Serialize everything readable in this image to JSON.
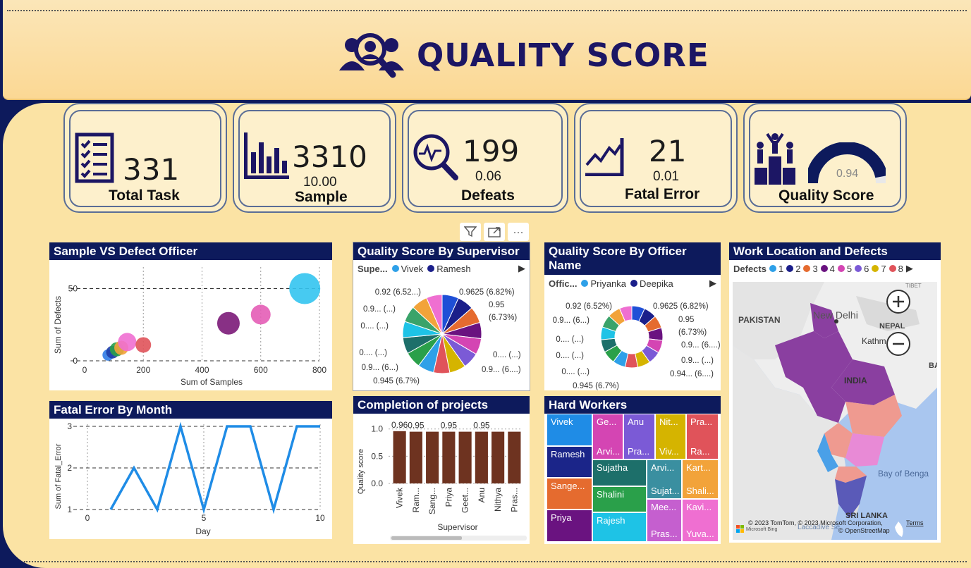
{
  "header": {
    "title": "QUALITY SCORE"
  },
  "kpis": [
    {
      "value": "331",
      "sub": "",
      "label": "Total Task",
      "icon": "checklist-icon"
    },
    {
      "value": "3310",
      "sub": "10.00",
      "label": "Sample",
      "icon": "bar-chart-icon"
    },
    {
      "value": "199",
      "sub": "0.06",
      "label": "Defeats",
      "icon": "magnify-pulse-icon"
    },
    {
      "value": "21",
      "sub": "0.01",
      "label": "Fatal Error",
      "icon": "line-chart-icon"
    },
    {
      "value": "",
      "sub": "0.94",
      "label": "Quality Score",
      "icon": "podium-icon",
      "gauge_fraction": 0.94
    }
  ],
  "toolbar": {
    "filter": "filter-icon",
    "focus": "focus-mode-icon",
    "more": "···"
  },
  "scatter": {
    "title": "Sample VS Defect Officer",
    "xlabel": "Sum of Samples",
    "ylabel": "Sum of Defects",
    "xticks": [
      "0",
      "200",
      "400",
      "600",
      "800"
    ],
    "yticks": [
      "0",
      "50"
    ]
  },
  "pie1": {
    "title": "Quality Score By Supervisor",
    "legend_head": "Supe...",
    "legend": [
      "Vivek",
      "Ramesh"
    ],
    "labels": [
      "0.92 (6.52...)",
      "0.9625 (6.82%)",
      "0.9... (...)",
      "0.95",
      "(6.73%)",
      "0.... (...)",
      "0.... (...)",
      "0.... (...)",
      "0.9... (6...)",
      "0.9... (6....)",
      "0.945 (6.7%)"
    ]
  },
  "pie2": {
    "title": "Quality Score By Officer Name",
    "legend_head": "Offic...",
    "legend": [
      "Priyanka",
      "Deepika"
    ],
    "labels": [
      "0.92 (6.52%)",
      "0.9625 (6.82%)",
      "0.9... (6...)",
      "0.95",
      "(6.73%)",
      "0.... (...)",
      "0.... (...)",
      "0.9... (...)",
      "0.... (...)",
      "0.94... (6....)",
      "0.9... (6....)",
      "0.945 (6.7%)"
    ]
  },
  "map": {
    "title": "Work Location and Defects",
    "legend_head": "Defects",
    "legend": [
      "1",
      "2",
      "3",
      "4",
      "5",
      "6",
      "7",
      "8"
    ],
    "places": [
      "PAKISTAN",
      "New Delhi",
      "NEPAL",
      "Kathm",
      "INDIA",
      "Bay of Benga",
      "SRI LANKA",
      "TIBET",
      "BA",
      "Laccadive Se"
    ],
    "attribution": "© 2023 TomTom, © 2023 Microsoft Corporation,",
    "terms": "Terms",
    "osm": "© OpenStreetMap",
    "bing": "Microsoft Bing"
  },
  "line": {
    "title": "Fatal Error By Month",
    "xlabel": "Day",
    "ylabel": "Sum of Fatal_Error",
    "xticks": [
      "0",
      "5",
      "10"
    ],
    "yticks": [
      "1",
      "2",
      "3"
    ]
  },
  "bars": {
    "title": "Completion of projects",
    "xlabel": "Supervisor",
    "ylabel": "Quality score",
    "yticks": [
      "0.0",
      "0.5",
      "1.0"
    ],
    "value_labels": [
      "0.96",
      "0.95",
      "0.95",
      "0.95"
    ]
  },
  "treemap": {
    "title": "Hard Workers",
    "cells": [
      {
        "top": "Vivek",
        "bottom": ""
      },
      {
        "top": "Ramesh",
        "bottom": ""
      },
      {
        "top": "Sange...",
        "bottom": ""
      },
      {
        "top": "Priya",
        "bottom": ""
      },
      {
        "top": "Ge...",
        "bottom": "Arvi..."
      },
      {
        "top": "Anu",
        "bottom": "Pra..."
      },
      {
        "top": "Nit...",
        "bottom": "Viv..."
      },
      {
        "top": "Pra...",
        "bottom": "Ra..."
      },
      {
        "top": "Sujatha",
        "bottom": ""
      },
      {
        "top": "Arvi...",
        "bottom": "Sujat..."
      },
      {
        "top": "Kart...",
        "bottom": "Shali..."
      },
      {
        "top": "Shalini",
        "bottom": ""
      },
      {
        "top": "Rajesh",
        "bottom": ""
      },
      {
        "top": "Mee...",
        "bottom": "Pras..."
      },
      {
        "top": "Kavi...",
        "bottom": "Yuva..."
      }
    ]
  },
  "chart_data": [
    {
      "type": "scatter",
      "title": "Sample VS Defect Officer",
      "xlabel": "Sum of Samples",
      "ylabel": "Sum of Defects",
      "xlim": [
        0,
        800
      ],
      "ylim": [
        0,
        60
      ],
      "points": [
        {
          "x": 80,
          "y": 4,
          "size": 8,
          "color": "#2f7be6"
        },
        {
          "x": 95,
          "y": 6,
          "size": 9,
          "color": "#1f3ea8"
        },
        {
          "x": 110,
          "y": 8,
          "size": 10,
          "color": "#2aa04a"
        },
        {
          "x": 125,
          "y": 9,
          "size": 10,
          "color": "#f2a33a"
        },
        {
          "x": 145,
          "y": 13,
          "size": 13,
          "color": "#ef6fd1"
        },
        {
          "x": 200,
          "y": 11,
          "size": 11,
          "color": "#e0535a"
        },
        {
          "x": 490,
          "y": 26,
          "size": 16,
          "color": "#7b1a78"
        },
        {
          "x": 600,
          "y": 32,
          "size": 14,
          "color": "#e45db6"
        },
        {
          "x": 750,
          "y": 50,
          "size": 22,
          "color": "#33c4f0"
        }
      ]
    },
    {
      "type": "pie",
      "title": "Quality Score By Supervisor",
      "values": [
        0.9625,
        0.95,
        0.95,
        0.94,
        0.94,
        0.945,
        0.945,
        0.94,
        0.94,
        0.945,
        0.945,
        0.94,
        0.94,
        0.945,
        0.92
      ],
      "colors": [
        "#1f4fd6",
        "#1b1f8a",
        "#e56b2f",
        "#6a1380",
        "#d445b3",
        "#7b5ad6",
        "#d5b400",
        "#e0535a",
        "#2ea0e8",
        "#2aa04a",
        "#1d6f6a",
        "#1ec3e6",
        "#3aa36a",
        "#f2a33a",
        "#ef6fd1"
      ]
    },
    {
      "type": "pie",
      "title": "Quality Score By Officer Name",
      "donut": true,
      "values": [
        0.9625,
        0.95,
        0.95,
        0.94,
        0.94,
        0.945,
        0.945,
        0.94,
        0.94,
        0.945,
        0.945,
        0.94,
        0.94,
        0.945,
        0.92
      ],
      "colors": [
        "#1f4fd6",
        "#1b1f8a",
        "#e56b2f",
        "#6a1380",
        "#d445b3",
        "#7b5ad6",
        "#d5b400",
        "#e0535a",
        "#2ea0e8",
        "#2aa04a",
        "#1d6f6a",
        "#1ec3e6",
        "#3aa36a",
        "#f2a33a",
        "#ef6fd1"
      ]
    },
    {
      "type": "line",
      "title": "Fatal Error By Month",
      "xlabel": "Day",
      "ylabel": "Sum of Fatal_Error",
      "xlim": [
        0,
        10
      ],
      "ylim": [
        1,
        3
      ],
      "x": [
        1,
        2,
        3,
        4,
        5,
        6,
        7,
        8,
        9,
        10
      ],
      "y": [
        1,
        2,
        1,
        3,
        1,
        3,
        3,
        1,
        3,
        3
      ]
    },
    {
      "type": "bar",
      "title": "Completion of projects",
      "xlabel": "Supervisor",
      "ylabel": "Quality score",
      "ylim": [
        0,
        1.1
      ],
      "categories": [
        "Vivek",
        "Ram...",
        "Sang...",
        "Priya",
        "Geet...",
        "Anu",
        "Nithya",
        "Pras..."
      ],
      "values": [
        0.96,
        0.95,
        0.95,
        0.95,
        0.95,
        0.95,
        0.95,
        0.95
      ],
      "labels": [
        "0.96",
        "0.95",
        "",
        "0.95",
        "",
        "0.95",
        "",
        ""
      ],
      "color": "#6e3320"
    }
  ]
}
